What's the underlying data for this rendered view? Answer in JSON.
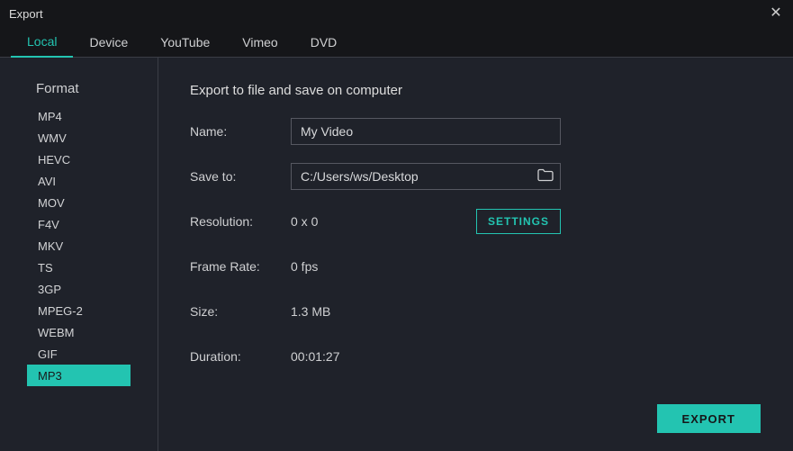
{
  "window": {
    "title": "Export"
  },
  "tabs": [
    {
      "label": "Local",
      "active": true
    },
    {
      "label": "Device",
      "active": false
    },
    {
      "label": "YouTube",
      "active": false
    },
    {
      "label": "Vimeo",
      "active": false
    },
    {
      "label": "DVD",
      "active": false
    }
  ],
  "sidebar": {
    "header": "Format",
    "items": [
      {
        "label": "MP4",
        "selected": false
      },
      {
        "label": "WMV",
        "selected": false
      },
      {
        "label": "HEVC",
        "selected": false
      },
      {
        "label": "AVI",
        "selected": false
      },
      {
        "label": "MOV",
        "selected": false
      },
      {
        "label": "F4V",
        "selected": false
      },
      {
        "label": "MKV",
        "selected": false
      },
      {
        "label": "TS",
        "selected": false
      },
      {
        "label": "3GP",
        "selected": false
      },
      {
        "label": "MPEG-2",
        "selected": false
      },
      {
        "label": "WEBM",
        "selected": false
      },
      {
        "label": "GIF",
        "selected": false
      },
      {
        "label": "MP3",
        "selected": true
      }
    ]
  },
  "main": {
    "subtitle": "Export to file and save on computer",
    "name_label": "Name:",
    "name_value": "My Video",
    "saveto_label": "Save to:",
    "saveto_value": "C:/Users/ws/Desktop",
    "resolution_label": "Resolution:",
    "resolution_value": "0 x 0",
    "framerate_label": "Frame Rate:",
    "framerate_value": "0 fps",
    "size_label": "Size:",
    "size_value": "1.3 MB",
    "duration_label": "Duration:",
    "duration_value": "00:01:27",
    "settings_button": "SETTINGS",
    "export_button": "EXPORT"
  },
  "colors": {
    "accent": "#23c4b1"
  }
}
